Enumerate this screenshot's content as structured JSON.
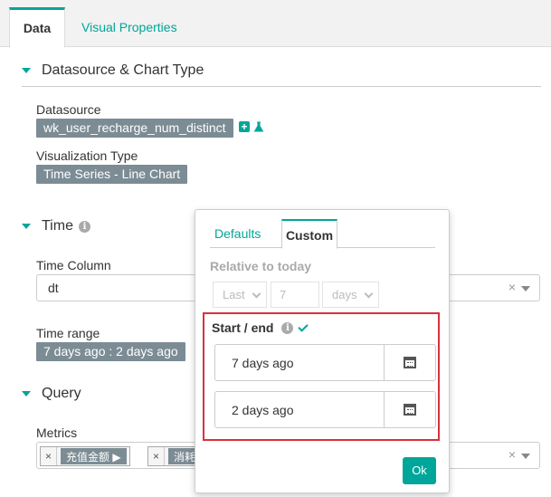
{
  "tabs": {
    "data": "Data",
    "visual": "Visual Properties"
  },
  "sections": {
    "datasource": {
      "title": "Datasource & Chart Type",
      "datasource_label": "Datasource",
      "datasource_value": "wk_user_recharge_num_distinct",
      "viz_label": "Visualization Type",
      "viz_value": "Time Series - Line Chart"
    },
    "time": {
      "title": "Time",
      "column_label": "Time Column",
      "column_value": "dt",
      "range_label": "Time range",
      "range_value": "7 days ago : 2 days ago"
    },
    "query": {
      "title": "Query",
      "metrics_label": "Metrics",
      "metrics": [
        {
          "label": "充值金额 ▶"
        },
        {
          "label": "消耗"
        }
      ]
    }
  },
  "popover": {
    "tabs": {
      "defaults": "Defaults",
      "custom": "Custom"
    },
    "relative_label": "Relative to today",
    "relative": {
      "direction": "Last",
      "amount": "7",
      "unit": "days"
    },
    "start_end_label": "Start / end",
    "start_value": "7 days ago",
    "end_value": "2 days ago",
    "ok_label": "Ok"
  },
  "colors": {
    "accent": "#00a699",
    "tag_bg": "#7c8c94",
    "highlight": "#d9303c"
  }
}
